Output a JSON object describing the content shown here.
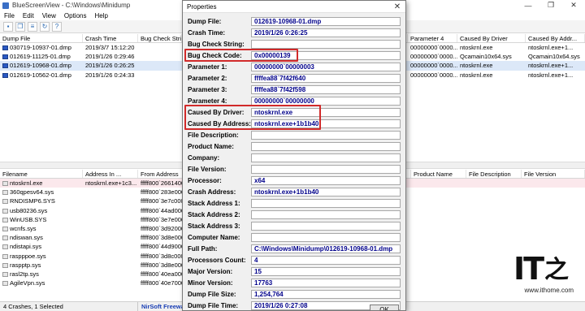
{
  "window": {
    "title": "BlueScreenView  -  C:\\Windows\\Minidump",
    "controls": [
      "—",
      "❐",
      "✕"
    ]
  },
  "menu": [
    "File",
    "Edit",
    "View",
    "Options",
    "Help"
  ],
  "toolbar_icons": [
    "save-icon",
    "copy-icon",
    "properties-icon",
    "refresh-icon",
    "about-icon"
  ],
  "top_grid": {
    "headers": [
      "Dump File",
      "Crash Time",
      "Bug Check String",
      "",
      "Parameter 4",
      "Caused By Driver",
      "Caused By Addr..."
    ],
    "rows": [
      {
        "file": "030719-10937-01.dmp",
        "time": "2019/3/7 15:12:20",
        "p4": "00000000`0000...",
        "driver": "ntoskrnl.exe",
        "addr": "ntoskrnl.exe+1...",
        "state": "normal"
      },
      {
        "file": "012619-11125-01.dmp",
        "time": "2019/1/26 0:29:46",
        "p4": "00000000`0000...",
        "driver": "Qcamain10x64.sys",
        "addr": "Qcamain10x64.sys",
        "state": "normal"
      },
      {
        "file": "012619-10968-01.dmp",
        "time": "2019/1/26 0:26:25",
        "p4": "00000000`0000...",
        "driver": "ntoskrnl.exe",
        "addr": "ntoskrnl.exe+1...",
        "state": "selected"
      },
      {
        "file": "012619-10562-01.dmp",
        "time": "2019/1/26 0:24:33",
        "p4": "00000000`0000...",
        "driver": "ntoskrnl.exe",
        "addr": "ntoskrnl.exe+1...",
        "state": "normal"
      }
    ]
  },
  "bottom_grid": {
    "headers": [
      "Filename",
      "Address In ...",
      "From Address",
      "",
      "Product Name",
      "File Description",
      "File Version"
    ],
    "rows": [
      {
        "file": "ntoskrnl.exe",
        "addr": "ntoskrnl.exe+1c3...",
        "from": "fffff800`2661400...",
        "state": "highlight"
      },
      {
        "file": "360qpesv64.sys",
        "addr": "",
        "from": "fffff800`283e000",
        "state": "normal"
      },
      {
        "file": "RNDISMP6.SYS",
        "addr": "",
        "from": "fffff800`3e7c000",
        "state": "normal"
      },
      {
        "file": "usb80236.sys",
        "addr": "",
        "from": "fffff800`44ad000",
        "state": "normal"
      },
      {
        "file": "WinUSB.SYS",
        "addr": "",
        "from": "fffff800`3e7e000",
        "state": "normal"
      },
      {
        "file": "wcnfs.sys",
        "addr": "",
        "from": "fffff800`3d92000",
        "state": "normal"
      },
      {
        "file": "ndiswan.sys",
        "addr": "",
        "from": "fffff800`3d8e000",
        "state": "normal"
      },
      {
        "file": "ndistapi.sys",
        "addr": "",
        "from": "fffff800`44d9000",
        "state": "normal"
      },
      {
        "file": "raspppoe.sys",
        "addr": "",
        "from": "fffff800`3d8c000",
        "state": "normal"
      },
      {
        "file": "raspptp.sys",
        "addr": "",
        "from": "fffff800`3d8e000",
        "state": "normal"
      },
      {
        "file": "rasl2tp.sys",
        "addr": "",
        "from": "fffff800`40ea000",
        "state": "normal"
      },
      {
        "file": "AgileVpn.sys",
        "addr": "",
        "from": "fffff800`40e7000",
        "state": "normal"
      }
    ]
  },
  "status": {
    "count": "4 Crashes, 1 Selected",
    "link": "NirSoft Freeware"
  },
  "dialog": {
    "title": "Properties",
    "close": "✕",
    "ok_label": "OK",
    "fields": [
      {
        "label": "Dump File:",
        "value": "012619-10968-01.dmp"
      },
      {
        "label": "Crash Time:",
        "value": "2019/1/26 0:26:25"
      },
      {
        "label": "Bug Check String:",
        "value": ""
      },
      {
        "label": "Bug Check Code:",
        "value": "0x00000139"
      },
      {
        "label": "Parameter 1:",
        "value": "00000000`00000003"
      },
      {
        "label": "Parameter 2:",
        "value": "ffffea88`7f42f640"
      },
      {
        "label": "Parameter 3:",
        "value": "ffffea88`7f42f598"
      },
      {
        "label": "Parameter 4:",
        "value": "00000000`00000000"
      },
      {
        "label": "Caused By Driver:",
        "value": "ntoskrnl.exe"
      },
      {
        "label": "Caused By Address:",
        "value": "ntoskrnl.exe+1b1b40"
      },
      {
        "label": "File Description:",
        "value": ""
      },
      {
        "label": "Product Name:",
        "value": ""
      },
      {
        "label": "Company:",
        "value": ""
      },
      {
        "label": "File Version:",
        "value": ""
      },
      {
        "label": "Processor:",
        "value": "x64"
      },
      {
        "label": "Crash Address:",
        "value": "ntoskrnl.exe+1b1b40"
      },
      {
        "label": "Stack Address 1:",
        "value": ""
      },
      {
        "label": "Stack Address 2:",
        "value": ""
      },
      {
        "label": "Stack Address 3:",
        "value": ""
      },
      {
        "label": "Computer Name:",
        "value": ""
      },
      {
        "label": "Full Path:",
        "value": "C:\\Windows\\Minidump\\012619-10968-01.dmp"
      },
      {
        "label": "Processors Count:",
        "value": "4"
      },
      {
        "label": "Major Version:",
        "value": "15"
      },
      {
        "label": "Minor Version:",
        "value": "17763"
      },
      {
        "label": "Dump File Size:",
        "value": "1,254,764"
      },
      {
        "label": "Dump File Time:",
        "value": "2019/1/26 0:27:08"
      }
    ]
  },
  "watermark": {
    "logo_it": "IT",
    "logo_char": "之",
    "url": "www.ithome.com"
  },
  "colors": {
    "highlight_box": "#d12a2a",
    "value_text": "#00008b",
    "selected_row": "#dce8f8",
    "highlight_row": "#fbe8ec"
  }
}
